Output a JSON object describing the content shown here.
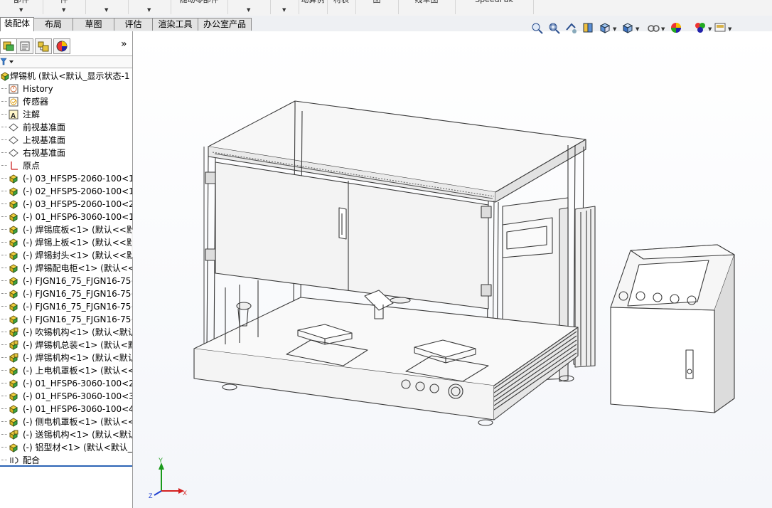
{
  "ribbon": {
    "items": [
      {
        "label": "部件",
        "has_arrow": true
      },
      {
        "label": "件",
        "has_arrow": true
      },
      {
        "label": "",
        "has_arrow": true
      },
      {
        "label": "",
        "has_arrow": true
      },
      {
        "label": "随动零部件",
        "has_arrow": false
      },
      {
        "label": "",
        "has_arrow": true
      },
      {
        "label": "",
        "has_arrow": true
      },
      {
        "label": "动算例",
        "has_arrow": false
      },
      {
        "label": "材表",
        "has_arrow": false
      },
      {
        "label": "图",
        "has_arrow": false
      },
      {
        "label": "线草图",
        "has_arrow": false
      },
      {
        "label": "SpeedPak",
        "has_arrow": false
      }
    ]
  },
  "tabs": {
    "items": [
      {
        "label": "装配体",
        "active": true
      },
      {
        "label": "布局",
        "active": false
      },
      {
        "label": "草图",
        "active": false
      },
      {
        "label": "评估",
        "active": false
      },
      {
        "label": "渲染工具",
        "active": false
      },
      {
        "label": "办公室产品",
        "active": false
      }
    ]
  },
  "panel": {
    "expand_label": "»",
    "tabs": [
      "featuremanager-icon",
      "propertymanager-icon",
      "configurationmanager-icon",
      "appearance-icon"
    ]
  },
  "tree": {
    "root": "焊锡机 (默认<默认_显示状态-1",
    "items": [
      {
        "label": "History",
        "icon": "history-icon"
      },
      {
        "label": "传感器",
        "icon": "sensor-icon"
      },
      {
        "label": "注解",
        "icon": "annotation-icon"
      },
      {
        "label": "前视基准面",
        "icon": "plane-icon"
      },
      {
        "label": "上视基准面",
        "icon": "plane-icon"
      },
      {
        "label": "右视基准面",
        "icon": "plane-icon"
      },
      {
        "label": "原点",
        "icon": "origin-icon"
      },
      {
        "label": "(-) 03_HFSP5-2060-100<1>",
        "icon": "part-icon"
      },
      {
        "label": "(-) 02_HFSP5-2060-100<1>",
        "icon": "part-icon"
      },
      {
        "label": "(-) 03_HFSP5-2060-100<2>",
        "icon": "part-icon"
      },
      {
        "label": "(-) 01_HFSP6-3060-100<1>",
        "icon": "part-icon"
      },
      {
        "label": "(-) 焊锡底板<1> (默认<<默",
        "icon": "part-icon"
      },
      {
        "label": "(-) 焊锡上板<1> (默认<<默",
        "icon": "part-icon"
      },
      {
        "label": "(-) 焊锡封头<1> (默认<<默",
        "icon": "part-icon"
      },
      {
        "label": "(-) 焊锡配电柜<1> (默认<<",
        "icon": "part-icon"
      },
      {
        "label": "(-) FJGN16_75_FJGN16-75<",
        "icon": "part-icon"
      },
      {
        "label": "(-) FJGN16_75_FJGN16-75<",
        "icon": "part-icon"
      },
      {
        "label": "(-) FJGN16_75_FJGN16-75<",
        "icon": "part-icon"
      },
      {
        "label": "(-) FJGN16_75_FJGN16-75<",
        "icon": "part-icon"
      },
      {
        "label": "(-) 吹锡机构<1> (默认<默认",
        "icon": "subassembly-icon"
      },
      {
        "label": "(-) 焊锡机总装<1> (默认<默",
        "icon": "subassembly-icon"
      },
      {
        "label": "(-) 焊锡机构<1> (默认<默认",
        "icon": "subassembly-icon"
      },
      {
        "label": "(-) 上电机罩板<1> (默认<<",
        "icon": "part-icon"
      },
      {
        "label": "(-) 01_HFSP6-3060-100<2>",
        "icon": "part-icon"
      },
      {
        "label": "(-) 01_HFSP6-3060-100<3>",
        "icon": "part-icon"
      },
      {
        "label": "(-) 01_HFSP6-3060-100<4>",
        "icon": "part-icon"
      },
      {
        "label": "(-) 侧电机罩板<1> (默认<<",
        "icon": "part-icon"
      },
      {
        "label": "(-) 送锡机构<1> (默认<默认",
        "icon": "subassembly-icon"
      },
      {
        "label": "(-) 铝型材<1> (默认<默认_显",
        "icon": "part-icon"
      },
      {
        "label": "配合",
        "icon": "mates-icon"
      }
    ]
  },
  "viewport": {
    "toolbar": [
      "zoom-to-fit-icon",
      "zoom-to-area-icon",
      "previous-view-icon",
      "section-view-icon",
      "view-orientation-icon",
      "display-style-icon",
      "hide-show-icon",
      "edit-appearance-icon",
      "apply-scene-icon",
      "view-settings-icon"
    ],
    "triad": {
      "x": "X",
      "y": "Y",
      "z": "Z"
    }
  },
  "colors": {
    "tab_active": "#ffffff",
    "panel_accent": "#2c63b5",
    "triad_x": "#d42020",
    "triad_y": "#1a9a1a",
    "triad_z": "#2040d0"
  }
}
